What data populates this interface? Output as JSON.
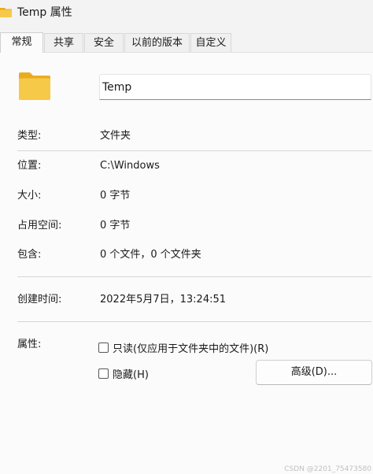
{
  "window": {
    "title": "Temp 属性",
    "folder_icon": "folder-icon"
  },
  "tabs": [
    {
      "label": "常规",
      "active": true
    },
    {
      "label": "共享",
      "active": false
    },
    {
      "label": "安全",
      "active": false
    },
    {
      "label": "以前的版本",
      "active": false
    },
    {
      "label": "自定义",
      "active": false
    }
  ],
  "general": {
    "folder_name": "Temp",
    "rows": [
      {
        "label": "类型:",
        "value": "文件夹"
      },
      {
        "label": "位置:",
        "value": "C:\\Windows"
      },
      {
        "label": "大小:",
        "value": "0 字节"
      },
      {
        "label": "占用空间:",
        "value": "0 字节"
      },
      {
        "label": "包含:",
        "value": "0 个文件，0 个文件夹"
      }
    ],
    "created": {
      "label": "创建时间:",
      "value": "2022年5月7日，13:24:51"
    },
    "attributes": {
      "label": "属性:",
      "readonly": "只读(仅应用于文件夹中的文件)(R)",
      "hidden": "隐藏(H)",
      "advanced_button": "高级(D)..."
    }
  },
  "colors": {
    "folder_yellow": "#f7c948",
    "folder_dark": "#e8ad1f"
  },
  "watermark": "CSDN @2201_75473580"
}
